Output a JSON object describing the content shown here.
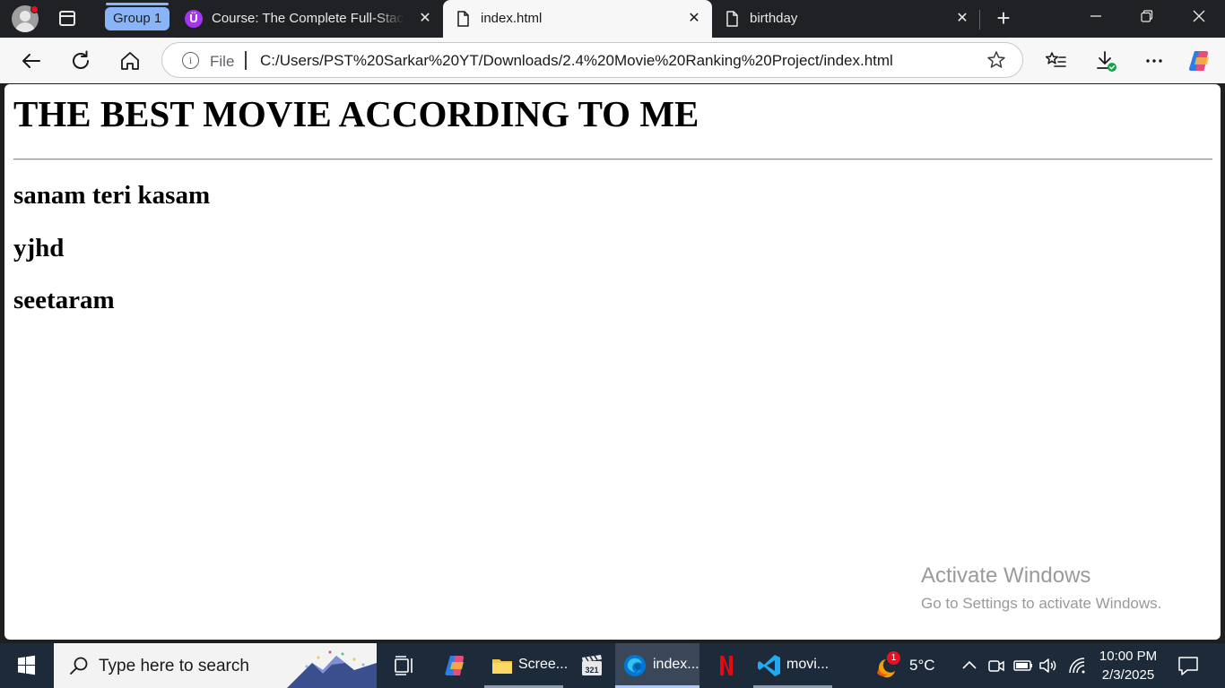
{
  "browser": {
    "tab_group_label": "Group 1",
    "tabs": [
      {
        "title": "Course: The Complete Full-Stack Web Development Bootcamp",
        "icon": "udemy-icon",
        "active": false
      },
      {
        "title": "index.html",
        "icon": "file-icon",
        "active": true
      },
      {
        "title": "birthday",
        "icon": "file-icon",
        "active": false
      }
    ],
    "new_tab_label": "+",
    "address": {
      "scheme_label": "File",
      "url": "C:/Users/PST%20Sarkar%20YT/Downloads/2.4%20Movie%20Ranking%20Project/index.html"
    }
  },
  "page": {
    "heading": "THE BEST MOVIE ACCORDING TO ME",
    "movies": [
      "sanam teri kasam",
      "yjhd",
      "seetaram"
    ],
    "watermark": {
      "line1": "Activate Windows",
      "line2": "Go to Settings to activate Windows."
    }
  },
  "taskbar": {
    "search_placeholder": "Type here to search",
    "apps": [
      {
        "name": "task-view",
        "label": ""
      },
      {
        "name": "copilot",
        "label": ""
      },
      {
        "name": "file-explorer",
        "label": "Scree..."
      },
      {
        "name": "media-player",
        "label": ""
      },
      {
        "name": "edge",
        "label": "index..."
      },
      {
        "name": "netflix",
        "label": ""
      },
      {
        "name": "vscode",
        "label": "movi..."
      }
    ],
    "weather": {
      "temp": "5°C",
      "badge": "1"
    },
    "clock": {
      "time": "10:00 PM",
      "date": "2/3/2025"
    }
  },
  "colors": {
    "tab_group": "#8ab4f8",
    "udemy": "#a435f0",
    "edge_blue": "#0078d4",
    "vscode_blue": "#23a9f2",
    "netflix_red": "#e50914",
    "taskbar_bg": "#1c2a3a"
  }
}
